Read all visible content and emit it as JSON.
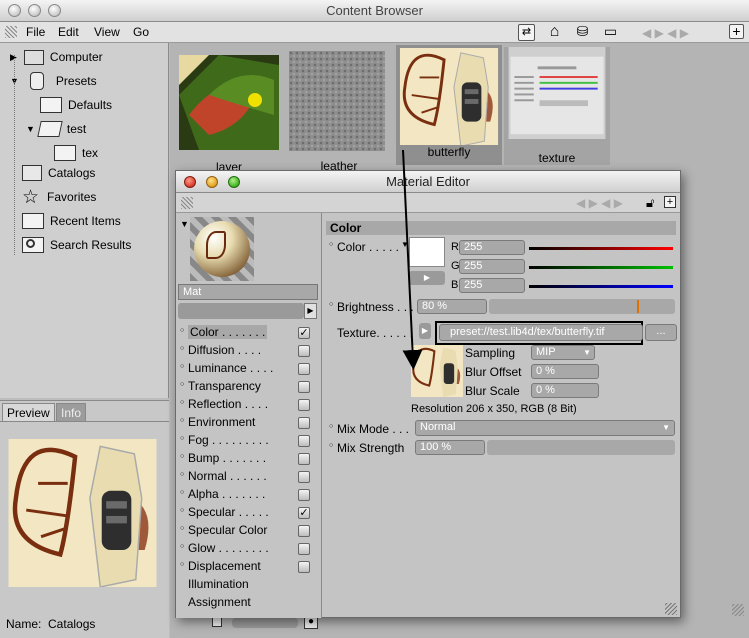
{
  "window": {
    "title": "Content Browser"
  },
  "menu": [
    "File",
    "Edit",
    "View",
    "Go"
  ],
  "toolbar_icons": [
    "browse-icon",
    "home-icon",
    "presets-icon",
    "catalog-icon"
  ],
  "tree": [
    {
      "label": "Computer",
      "icon": "computer-icon"
    },
    {
      "label": "Presets",
      "icon": "presets-icon"
    },
    {
      "label": "Defaults",
      "icon": "folder-icon"
    },
    {
      "label": "test",
      "icon": "folder-open-icon"
    },
    {
      "label": "tex",
      "icon": "folder-icon"
    },
    {
      "label": "Catalogs",
      "icon": "catalog-icon"
    },
    {
      "label": "Favorites",
      "icon": "star-icon"
    },
    {
      "label": "Recent Items",
      "icon": "recent-icon"
    },
    {
      "label": "Search Results",
      "icon": "search-icon"
    }
  ],
  "thumbnails": [
    "layer",
    "leather",
    "butterfly",
    "texture"
  ],
  "preview": {
    "tabs": [
      "Preview",
      "Info"
    ],
    "name_label": "Name:",
    "name_value": "Catalogs"
  },
  "material_editor": {
    "title": "Material Editor",
    "material_name": "Mat",
    "channels": [
      {
        "label": "Color . . . . . . .",
        "checked": true
      },
      {
        "label": "Diffusion . . . .",
        "checked": false
      },
      {
        "label": "Luminance . . . .",
        "checked": false
      },
      {
        "label": "Transparency",
        "checked": false
      },
      {
        "label": "Reflection . . . .",
        "checked": false
      },
      {
        "label": "Environment",
        "checked": false
      },
      {
        "label": "Fog . . . . . . . . .",
        "checked": false
      },
      {
        "label": "Bump . . . . . . .",
        "checked": false
      },
      {
        "label": "Normal . . . . . .",
        "checked": false
      },
      {
        "label": "Alpha . . . . . . .",
        "checked": false
      },
      {
        "label": "Specular . . . . .",
        "checked": true
      },
      {
        "label": "Specular Color",
        "checked": false
      },
      {
        "label": "Glow . . . . . . . .",
        "checked": false
      },
      {
        "label": "Displacement",
        "checked": false
      },
      {
        "label": "Illumination",
        "checked": null
      },
      {
        "label": "Assignment",
        "checked": null
      }
    ],
    "section": "Color",
    "color_label": "Color . . . . .",
    "r_label": "R",
    "r": "255",
    "g_label": "G",
    "g": "255",
    "b_label": "B",
    "b": "255",
    "brightness_label": "Brightness . . .",
    "brightness": "80 %",
    "texture_label": "Texture. . . . . .",
    "texture_path": "preset://test.lib4d/tex/butterfly.tif",
    "texture_button": "...",
    "sampling_label": "Sampling",
    "sampling": "MIP",
    "blur_offset_label": "Blur Offset",
    "blur_offset": "0 %",
    "blur_scale_label": "Blur Scale",
    "blur_scale": "0 %",
    "resolution": "Resolution 206 x 350, RGB (8 Bit)",
    "mix_mode_label": "Mix Mode . . .",
    "mix_mode": "Normal",
    "mix_strength_label": "Mix Strength",
    "mix_strength": "100 %"
  }
}
